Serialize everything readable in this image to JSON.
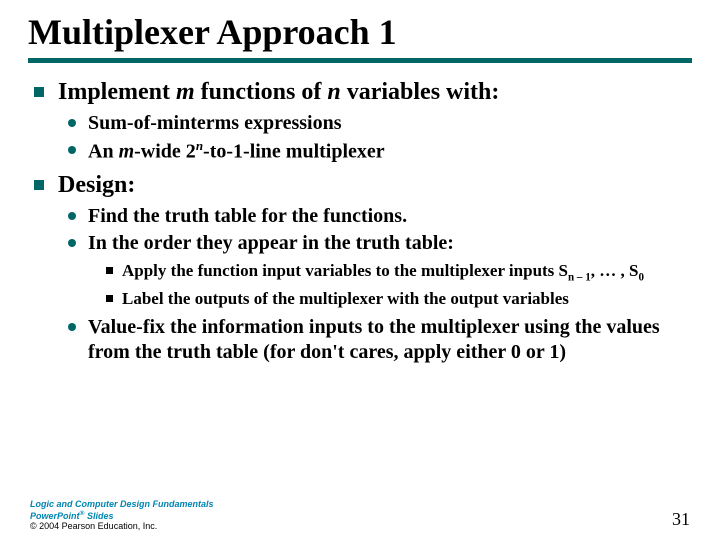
{
  "title": "Multiplexer Approach 1",
  "bullets": {
    "implement_pre": "Implement ",
    "implement_mid": " functions of ",
    "implement_post": " variables with:",
    "m": "m",
    "n": "n",
    "som": "Sum-of-minterms expressions",
    "mux_pre": "An ",
    "mux_mwide": "-wide 2",
    "mux_post": "-to-1-line multiplexer",
    "design": "Design:",
    "truth": "Find the truth table for the functions.",
    "order": "In the order they appear in the truth table:",
    "apply_pre": "Apply the function input variables to the multiplexer inputs S",
    "apply_mid": ", … , S",
    "nminus1": "n – 1",
    "zero": "0",
    "label": "Label the outputs of the multiplexer with the output variables",
    "valuefix": "Value-fix the information inputs to the multiplexer using the values from the truth table (for don't cares, apply either 0 or 1)"
  },
  "footer": {
    "line1": "Logic and Computer Design Fundamentals",
    "line2a": "PowerPoint",
    "reg": "®",
    "line2b": " Slides",
    "copyright": "© 2004 Pearson Education, Inc."
  },
  "page_number": "31"
}
